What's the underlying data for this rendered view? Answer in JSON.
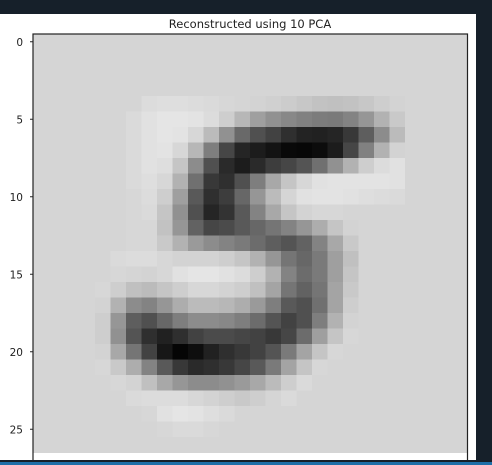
{
  "chart_data": {
    "type": "heatmap",
    "title": "Reconstructed using 10 PCA",
    "xlabel": "",
    "ylabel": "",
    "colormap": "gray_r",
    "yticks": [
      0,
      5,
      10,
      15,
      20,
      25
    ],
    "visible_rows": [
      0,
      26
    ],
    "cols": 28,
    "background_value": 0.09,
    "values": [
      [
        0.09,
        0.09,
        0.09,
        0.09,
        0.09,
        0.09,
        0.09,
        0.09,
        0.09,
        0.09,
        0.09,
        0.09,
        0.09,
        0.09,
        0.09,
        0.09,
        0.09,
        0.09,
        0.09,
        0.09,
        0.09,
        0.09,
        0.09,
        0.09,
        0.09,
        0.09,
        0.09,
        0.09
      ],
      [
        0.09,
        0.09,
        0.09,
        0.09,
        0.09,
        0.09,
        0.09,
        0.09,
        0.09,
        0.09,
        0.09,
        0.09,
        0.09,
        0.09,
        0.09,
        0.09,
        0.09,
        0.09,
        0.09,
        0.09,
        0.09,
        0.09,
        0.09,
        0.09,
        0.09,
        0.09,
        0.09,
        0.09
      ],
      [
        0.09,
        0.09,
        0.09,
        0.09,
        0.09,
        0.09,
        0.09,
        0.09,
        0.09,
        0.09,
        0.09,
        0.09,
        0.09,
        0.09,
        0.09,
        0.09,
        0.09,
        0.09,
        0.09,
        0.09,
        0.09,
        0.09,
        0.09,
        0.09,
        0.09,
        0.09,
        0.09,
        0.09
      ],
      [
        0.09,
        0.09,
        0.09,
        0.09,
        0.09,
        0.09,
        0.09,
        0.09,
        0.09,
        0.09,
        0.09,
        0.09,
        0.09,
        0.09,
        0.09,
        0.09,
        0.09,
        0.09,
        0.09,
        0.09,
        0.09,
        0.09,
        0.09,
        0.09,
        0.09,
        0.09,
        0.09,
        0.09
      ],
      [
        0.09,
        0.09,
        0.09,
        0.09,
        0.09,
        0.09,
        0.09,
        0.06,
        0.05,
        0.05,
        0.06,
        0.07,
        0.08,
        0.09,
        0.1,
        0.11,
        0.13,
        0.15,
        0.17,
        0.18,
        0.17,
        0.15,
        0.12,
        0.1,
        0.09,
        0.09,
        0.09,
        0.09
      ],
      [
        0.09,
        0.09,
        0.09,
        0.09,
        0.09,
        0.09,
        0.07,
        0.04,
        0.02,
        0.02,
        0.03,
        0.06,
        0.12,
        0.22,
        0.32,
        0.38,
        0.42,
        0.45,
        0.47,
        0.48,
        0.44,
        0.36,
        0.24,
        0.14,
        0.09,
        0.09,
        0.09,
        0.09
      ],
      [
        0.09,
        0.09,
        0.09,
        0.09,
        0.09,
        0.09,
        0.07,
        0.04,
        0.02,
        0.03,
        0.08,
        0.2,
        0.38,
        0.55,
        0.66,
        0.72,
        0.8,
        0.85,
        0.86,
        0.84,
        0.76,
        0.6,
        0.4,
        0.2,
        0.09,
        0.09,
        0.09,
        0.09
      ],
      [
        0.09,
        0.09,
        0.09,
        0.09,
        0.09,
        0.09,
        0.07,
        0.04,
        0.03,
        0.08,
        0.22,
        0.46,
        0.7,
        0.84,
        0.88,
        0.92,
        0.96,
        0.97,
        0.95,
        0.88,
        0.7,
        0.45,
        0.24,
        0.1,
        0.09,
        0.09,
        0.09,
        0.09
      ],
      [
        0.09,
        0.09,
        0.09,
        0.09,
        0.09,
        0.09,
        0.07,
        0.04,
        0.05,
        0.16,
        0.4,
        0.66,
        0.82,
        0.88,
        0.82,
        0.74,
        0.7,
        0.64,
        0.52,
        0.38,
        0.24,
        0.12,
        0.06,
        0.04,
        0.09,
        0.09,
        0.09,
        0.09
      ],
      [
        0.09,
        0.09,
        0.09,
        0.09,
        0.09,
        0.09,
        0.07,
        0.05,
        0.08,
        0.24,
        0.52,
        0.76,
        0.8,
        0.66,
        0.46,
        0.28,
        0.16,
        0.08,
        0.04,
        0.03,
        0.03,
        0.03,
        0.03,
        0.04,
        0.09,
        0.09,
        0.09,
        0.09
      ],
      [
        0.09,
        0.09,
        0.09,
        0.09,
        0.09,
        0.09,
        0.08,
        0.06,
        0.12,
        0.32,
        0.62,
        0.8,
        0.74,
        0.56,
        0.36,
        0.2,
        0.09,
        0.04,
        0.03,
        0.03,
        0.04,
        0.05,
        0.06,
        0.07,
        0.09,
        0.09,
        0.09,
        0.09
      ],
      [
        0.09,
        0.09,
        0.09,
        0.09,
        0.09,
        0.09,
        0.08,
        0.07,
        0.16,
        0.38,
        0.66,
        0.84,
        0.78,
        0.62,
        0.44,
        0.28,
        0.16,
        0.1,
        0.08,
        0.08,
        0.09,
        0.09,
        0.09,
        0.09,
        0.09,
        0.09,
        0.09,
        0.09
      ],
      [
        0.09,
        0.09,
        0.09,
        0.09,
        0.09,
        0.09,
        0.08,
        0.08,
        0.17,
        0.36,
        0.58,
        0.7,
        0.68,
        0.62,
        0.56,
        0.5,
        0.44,
        0.36,
        0.26,
        0.16,
        0.1,
        0.09,
        0.09,
        0.09,
        0.09,
        0.09,
        0.09,
        0.09
      ],
      [
        0.09,
        0.09,
        0.09,
        0.09,
        0.09,
        0.09,
        0.08,
        0.08,
        0.14,
        0.24,
        0.34,
        0.4,
        0.44,
        0.48,
        0.54,
        0.6,
        0.64,
        0.58,
        0.44,
        0.28,
        0.14,
        0.09,
        0.09,
        0.09,
        0.09,
        0.09,
        0.09,
        0.09
      ],
      [
        0.09,
        0.09,
        0.09,
        0.09,
        0.09,
        0.07,
        0.06,
        0.06,
        0.08,
        0.1,
        0.1,
        0.1,
        0.12,
        0.16,
        0.24,
        0.36,
        0.5,
        0.56,
        0.48,
        0.32,
        0.18,
        0.09,
        0.09,
        0.09,
        0.09,
        0.09,
        0.09,
        0.09
      ],
      [
        0.09,
        0.09,
        0.09,
        0.09,
        0.09,
        0.08,
        0.09,
        0.1,
        0.08,
        0.04,
        0.02,
        0.02,
        0.04,
        0.06,
        0.12,
        0.24,
        0.44,
        0.54,
        0.48,
        0.32,
        0.16,
        0.09,
        0.09,
        0.09,
        0.09,
        0.09,
        0.09,
        0.09
      ],
      [
        0.09,
        0.09,
        0.09,
        0.09,
        0.08,
        0.12,
        0.18,
        0.2,
        0.16,
        0.12,
        0.08,
        0.08,
        0.1,
        0.12,
        0.18,
        0.3,
        0.5,
        0.58,
        0.5,
        0.3,
        0.14,
        0.09,
        0.09,
        0.09,
        0.09,
        0.09,
        0.09,
        0.09
      ],
      [
        0.09,
        0.09,
        0.09,
        0.09,
        0.1,
        0.24,
        0.4,
        0.44,
        0.36,
        0.26,
        0.2,
        0.2,
        0.22,
        0.26,
        0.34,
        0.46,
        0.62,
        0.66,
        0.52,
        0.3,
        0.12,
        0.09,
        0.09,
        0.09,
        0.09,
        0.09,
        0.09,
        0.09
      ],
      [
        0.09,
        0.09,
        0.09,
        0.09,
        0.12,
        0.36,
        0.6,
        0.66,
        0.56,
        0.46,
        0.4,
        0.4,
        0.42,
        0.46,
        0.54,
        0.64,
        0.72,
        0.66,
        0.46,
        0.24,
        0.1,
        0.09,
        0.09,
        0.09,
        0.09,
        0.09,
        0.09,
        0.09
      ],
      [
        0.09,
        0.09,
        0.09,
        0.09,
        0.12,
        0.38,
        0.64,
        0.8,
        0.86,
        0.8,
        0.72,
        0.68,
        0.68,
        0.7,
        0.72,
        0.76,
        0.7,
        0.54,
        0.32,
        0.16,
        0.08,
        0.09,
        0.09,
        0.09,
        0.09,
        0.09,
        0.09,
        0.09
      ],
      [
        0.09,
        0.09,
        0.09,
        0.09,
        0.1,
        0.28,
        0.5,
        0.72,
        0.9,
        0.98,
        0.94,
        0.86,
        0.8,
        0.76,
        0.72,
        0.64,
        0.48,
        0.3,
        0.16,
        0.08,
        0.09,
        0.09,
        0.09,
        0.09,
        0.09,
        0.09,
        0.09,
        0.09
      ],
      [
        0.09,
        0.09,
        0.09,
        0.09,
        0.08,
        0.14,
        0.26,
        0.44,
        0.62,
        0.76,
        0.82,
        0.8,
        0.76,
        0.7,
        0.62,
        0.48,
        0.3,
        0.16,
        0.08,
        0.09,
        0.09,
        0.09,
        0.09,
        0.09,
        0.09,
        0.09,
        0.09,
        0.09
      ],
      [
        0.09,
        0.09,
        0.09,
        0.09,
        0.09,
        0.08,
        0.1,
        0.18,
        0.28,
        0.36,
        0.4,
        0.4,
        0.38,
        0.34,
        0.28,
        0.2,
        0.12,
        0.07,
        0.09,
        0.09,
        0.09,
        0.09,
        0.09,
        0.09,
        0.09,
        0.09,
        0.09,
        0.09
      ],
      [
        0.09,
        0.09,
        0.09,
        0.09,
        0.09,
        0.09,
        0.07,
        0.06,
        0.06,
        0.06,
        0.08,
        0.1,
        0.12,
        0.14,
        0.12,
        0.09,
        0.07,
        0.09,
        0.09,
        0.09,
        0.09,
        0.09,
        0.09,
        0.09,
        0.09,
        0.09,
        0.09,
        0.09
      ],
      [
        0.09,
        0.09,
        0.09,
        0.09,
        0.09,
        0.09,
        0.09,
        0.08,
        0.04,
        0.02,
        0.03,
        0.05,
        0.07,
        0.09,
        0.09,
        0.09,
        0.09,
        0.09,
        0.09,
        0.09,
        0.09,
        0.09,
        0.09,
        0.09,
        0.09,
        0.09,
        0.09,
        0.09
      ],
      [
        0.09,
        0.09,
        0.09,
        0.09,
        0.09,
        0.09,
        0.09,
        0.09,
        0.08,
        0.07,
        0.07,
        0.08,
        0.09,
        0.09,
        0.09,
        0.09,
        0.09,
        0.09,
        0.09,
        0.09,
        0.09,
        0.09,
        0.09,
        0.09,
        0.09,
        0.09,
        0.09,
        0.09
      ],
      [
        0.09,
        0.09,
        0.09,
        0.09,
        0.09,
        0.09,
        0.09,
        0.09,
        0.09,
        0.09,
        0.09,
        0.09,
        0.09,
        0.09,
        0.09,
        0.09,
        0.09,
        0.09,
        0.09,
        0.09,
        0.09,
        0.09,
        0.09,
        0.09,
        0.09,
        0.09,
        0.09,
        0.09
      ]
    ]
  },
  "colors": {
    "background": "#16202a",
    "panel": "#ffffff",
    "axes_border": "#222222",
    "accent_strip": "#1e6fa8"
  }
}
